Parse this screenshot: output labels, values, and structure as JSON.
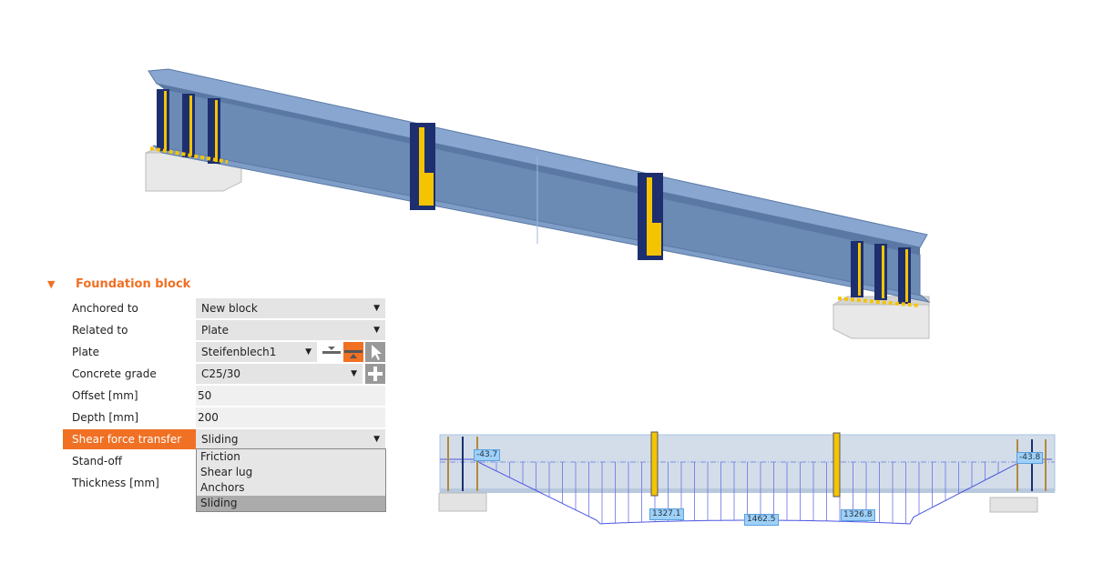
{
  "section": {
    "title": "Foundation block",
    "expand_icon": "triangle-down-icon"
  },
  "properties": [
    {
      "label": "Anchored to",
      "value": "New block",
      "type": "select"
    },
    {
      "label": "Related to",
      "value": "Plate",
      "type": "select"
    },
    {
      "label": "Plate",
      "value": "Steifenblech1",
      "type": "select"
    },
    {
      "label": "Concrete grade",
      "value": "C25/30",
      "type": "select"
    },
    {
      "label": "Offset [mm]",
      "value": "50",
      "type": "text"
    },
    {
      "label": "Depth [mm]",
      "value": "200",
      "type": "text"
    },
    {
      "label": "Shear force transfer",
      "value": "Sliding",
      "type": "select",
      "selected": true
    },
    {
      "label": "Stand-off",
      "value": "",
      "type": "select"
    },
    {
      "label": "Thickness [mm]",
      "value": "",
      "type": "text"
    }
  ],
  "dropdown_options": [
    "Friction",
    "Shear lug",
    "Anchors",
    "Sliding"
  ],
  "dropdown_selected": "Sliding",
  "plate_buttons": [
    "plate-align-top-icon",
    "plate-align-bottom-icon",
    "pick-cursor-icon"
  ],
  "concrete_button": "add-icon",
  "diagram_labels": [
    "-43.7",
    "1327.1",
    "1462.5",
    "1326.8",
    "-43.8"
  ],
  "colors": {
    "accent": "#f07024",
    "steel": "#6f8fb8",
    "stiffener": "#1d2f6e",
    "weld": "#f5c400"
  }
}
